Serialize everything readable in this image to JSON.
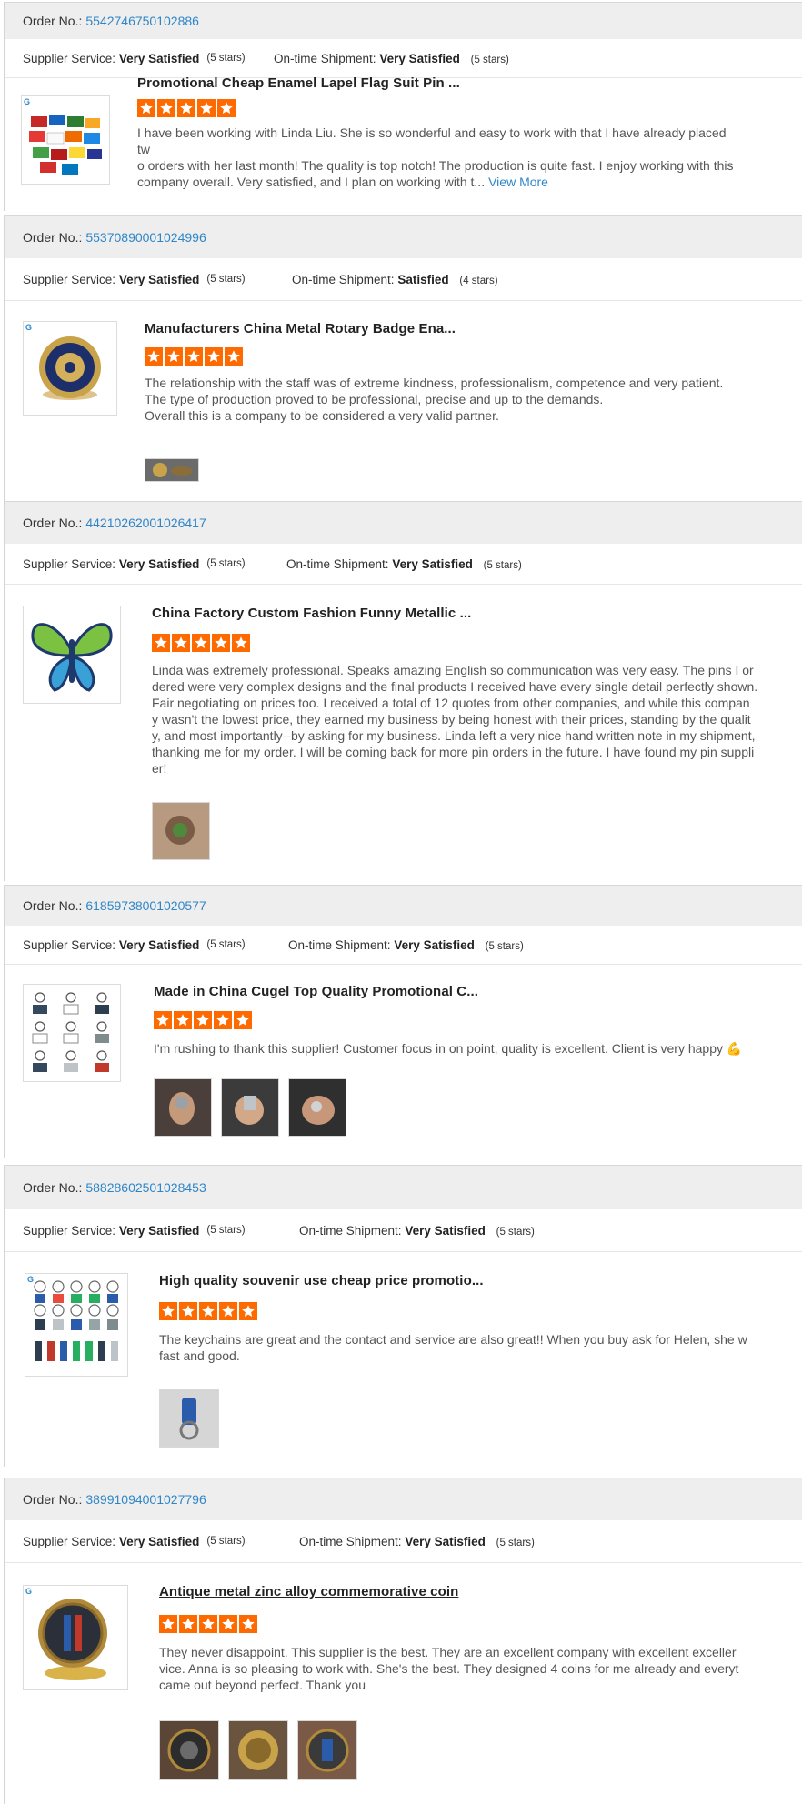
{
  "labels": {
    "order_no": "Order No.:",
    "supplier_service": "Supplier Service:",
    "ontime_shipment": "On-time Shipment:",
    "view_more": "View More"
  },
  "colors": {
    "star": "#ff6a00",
    "link": "#2f86c7",
    "bar": "#eeeeee"
  },
  "reviews": [
    {
      "order_no": "5542746750102886",
      "service_rating": "Very Satisfied",
      "service_stars": "(5 stars)",
      "shipment_rating": "Very Satisfied",
      "shipment_stars": "(5 stars)",
      "product_title": "Promotional Cheap Enamel Lapel Flag Suit Pin ...",
      "stars": 5,
      "review_lines": [
        "I have been working with Linda Liu. She is so wonderful and easy to work with that I have already placed tw",
        "o orders with her last month! The quality is top notch! The production is quite fast. I enjoy working with this",
        "company overall. Very satisfied, and I plan on working with t..."
      ],
      "photos": 0
    },
    {
      "order_no": "55370890001024996",
      "service_rating": "Very Satisfied",
      "service_stars": "(5 stars)",
      "shipment_rating": "Satisfied",
      "shipment_stars": "(4 stars)",
      "product_title": "Manufacturers China Metal Rotary Badge Ena...",
      "stars": 5,
      "review_lines": [
        "The relationship with the staff was of extreme kindness, professionalism, competence and very patient.",
        "The type of production proved to be professional, precise and up to the demands.",
        "Overall this is a company to be considered a very valid partner."
      ],
      "photos": 1
    },
    {
      "order_no": "44210262001026417",
      "service_rating": "Very Satisfied",
      "service_stars": "(5 stars)",
      "shipment_rating": "Very Satisfied",
      "shipment_stars": "(5 stars)",
      "product_title": "China Factory Custom Fashion Funny Metallic ...",
      "stars": 5,
      "review_lines": [
        "Linda was extremely professional. Speaks amazing English so communication was very easy. The pins I or",
        "dered were very complex designs and the final products I received have every single detail perfectly shown.",
        "Fair negotiating on prices too. I received a total of 12 quotes from other companies, and while this compan",
        "y wasn't the lowest price, they earned my business by being honest with their prices, standing by the qualit",
        "y, and most importantly--by asking for my business. Linda left a very nice hand written note in my shipment,",
        "thanking me for my order. I will be coming back for more pin orders in the future. I have found my pin suppli",
        "er!"
      ],
      "photos": 1
    },
    {
      "order_no": "61859738001020577",
      "service_rating": "Very Satisfied",
      "service_stars": "(5 stars)",
      "shipment_rating": "Very Satisfied",
      "shipment_stars": "(5 stars)",
      "product_title": "Made in China Cugel Top Quality Promotional C...",
      "stars": 5,
      "review_lines": [
        "I'm rushing to thank this supplier! Customer focus in on point, quality is excellent. Client is very happy 💪"
      ],
      "photos": 3
    },
    {
      "order_no": "58828602501028453",
      "service_rating": "Very Satisfied",
      "service_stars": "(5 stars)",
      "shipment_rating": "Very Satisfied",
      "shipment_stars": "(5 stars)",
      "product_title": "High quality souvenir use cheap price promotio...",
      "stars": 5,
      "review_lines": [
        "The keychains are great and the contact and service are also great!! When you buy ask for Helen, she w",
        "fast and good."
      ],
      "photos": 1
    },
    {
      "order_no": "38991094001027796",
      "service_rating": "Very Satisfied",
      "service_stars": "(5 stars)",
      "shipment_rating": "Very Satisfied",
      "shipment_stars": "(5 stars)",
      "product_title": "Antique metal zinc alloy commemorative coin",
      "stars": 5,
      "review_lines": [
        "They never disappoint. This supplier is the best. They are an excellent company with excellent exceller",
        "vice. Anna is so pleasing to work with. She's the best. They designed 4 coins for me already and everyt",
        "came out beyond perfect. Thank you"
      ],
      "photos": 3
    }
  ]
}
